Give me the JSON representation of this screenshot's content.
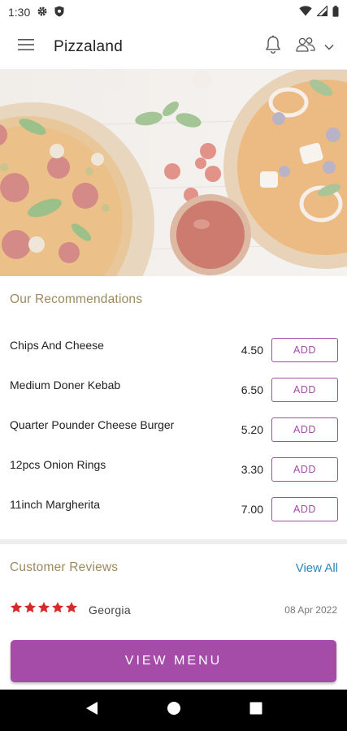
{
  "status_bar": {
    "time": "1:30"
  },
  "app_bar": {
    "title": "Pizzaland"
  },
  "recommendations": {
    "title": "Our Recommendations",
    "items": [
      {
        "name": "Chips And Cheese",
        "price": "4.50",
        "button": "ADD"
      },
      {
        "name": "Medium Doner Kebab",
        "price": "6.50",
        "button": "ADD"
      },
      {
        "name": "Quarter Pounder Cheese Burger",
        "price": "5.20",
        "button": "ADD"
      },
      {
        "name": "12pcs Onion Rings",
        "price": "3.30",
        "button": "ADD"
      },
      {
        "name": "11inch Margherita",
        "price": "7.00",
        "button": "ADD"
      }
    ]
  },
  "reviews": {
    "title": "Customer Reviews",
    "view_all": "View All",
    "items": [
      {
        "rating": 5,
        "name": "Georgia",
        "date": "08 Apr 2022"
      }
    ]
  },
  "cta": {
    "label": "VIEW MENU"
  },
  "colors": {
    "accent": "#a54ba8",
    "section_title": "#9c8a5f",
    "link": "#2986b5",
    "star": "#d42a2a"
  },
  "icons": {
    "status": [
      "gear-icon",
      "shield-icon",
      "wifi-icon",
      "signal-icon",
      "battery-icon"
    ],
    "app_bar": [
      "menu-icon",
      "bell-icon",
      "people-icon",
      "chevron-down-icon"
    ],
    "nav": [
      "back-icon",
      "home-icon",
      "recents-icon"
    ]
  }
}
